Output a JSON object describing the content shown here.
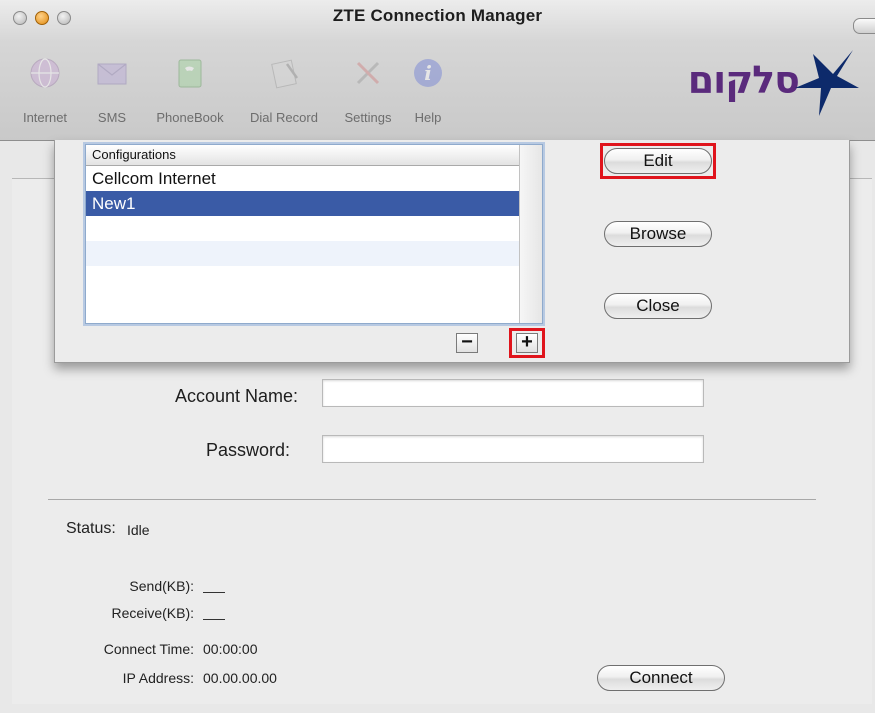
{
  "window": {
    "title": "ZTE Connection Manager"
  },
  "toolbar": {
    "items": [
      {
        "label": "Internet",
        "icon": "globe-icon"
      },
      {
        "label": "SMS",
        "icon": "envelope-icon"
      },
      {
        "label": "PhoneBook",
        "icon": "phonebook-icon"
      },
      {
        "label": "Dial Record",
        "icon": "notepad-icon"
      },
      {
        "label": "Settings",
        "icon": "tools-icon"
      },
      {
        "label": "Help",
        "icon": "info-icon"
      }
    ],
    "brand": {
      "text": "סלקום",
      "accent": "#5a2a7c",
      "star_color": "#0d2a6b"
    }
  },
  "sheet": {
    "column_header": "Configurations",
    "configurations": [
      "Cellcom Internet",
      "New1"
    ],
    "selected_index": 1,
    "edit_label": "Edit",
    "browse_label": "Browse",
    "close_label": "Close",
    "remove_label": "−",
    "add_label": "+"
  },
  "form": {
    "account_name_label": "Account Name:",
    "account_name_value": "",
    "password_label": "Password:",
    "password_value": ""
  },
  "status": {
    "status_label": "Status:",
    "status_value": "Idle",
    "send_label": "Send(KB):",
    "send_value": "___",
    "receive_label": "Receive(KB):",
    "receive_value": "___",
    "connect_time_label": "Connect Time:",
    "connect_time_value": "00:00:00",
    "ip_label": "IP Address:",
    "ip_value": "00.00.00.00"
  },
  "connect_label": "Connect",
  "colors": {
    "selection": "#3a5ba6",
    "highlight_box": "#e0141c"
  }
}
